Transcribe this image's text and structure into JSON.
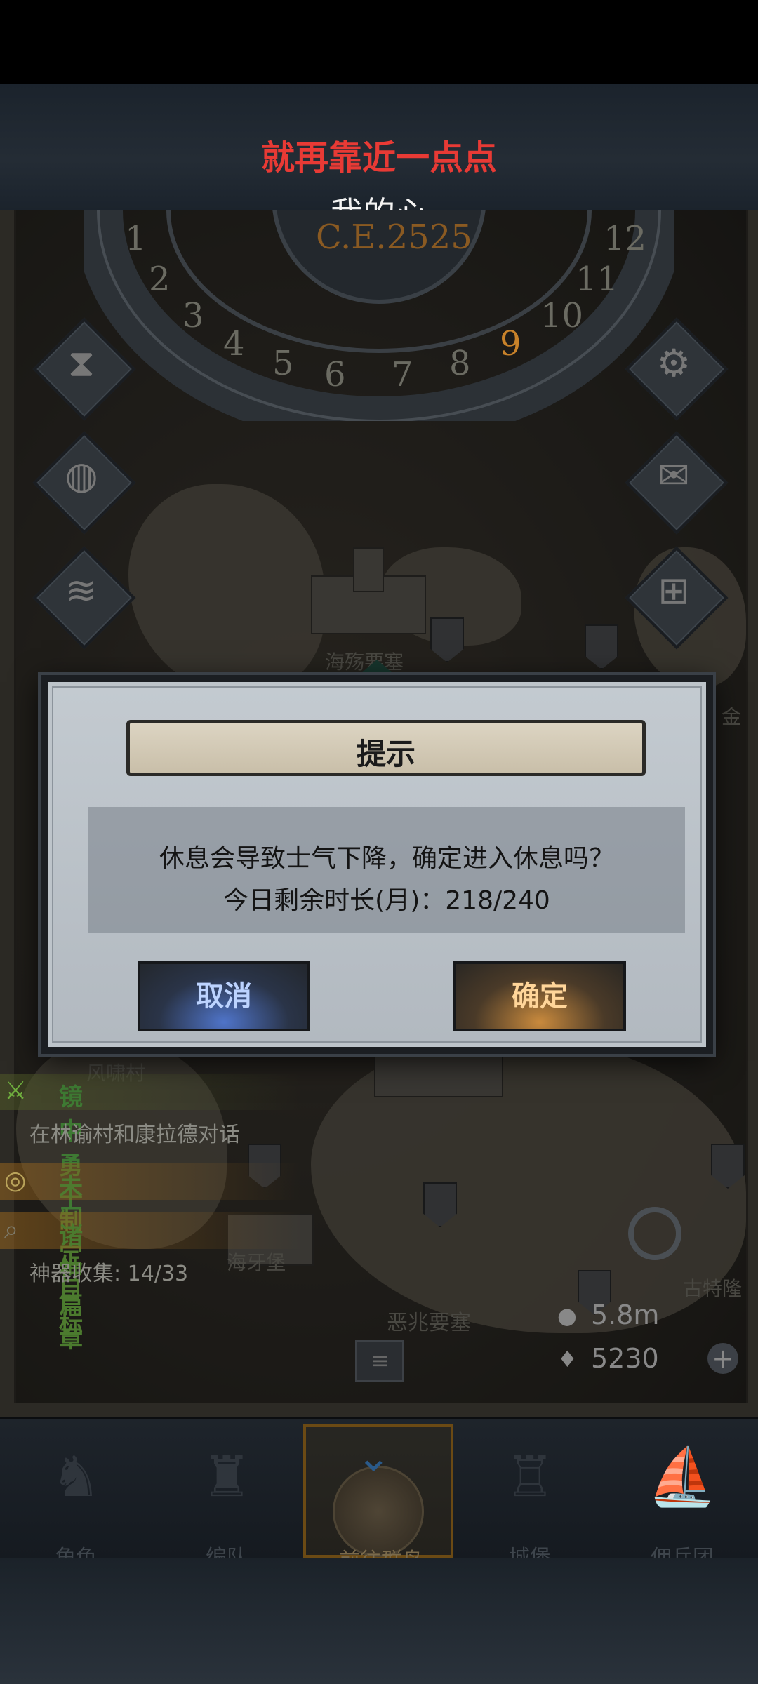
{
  "header": {
    "line1": "就再靠近一点点",
    "line2": "我的心",
    "line1_color": "#e83a35"
  },
  "dial": {
    "year": "C.E.2525",
    "numbers": [
      "1",
      "2",
      "3",
      "4",
      "5",
      "6",
      "7",
      "8",
      "9",
      "10",
      "11",
      "12"
    ],
    "active_month": "9"
  },
  "side_buttons": {
    "left": [
      "hourglass-icon",
      "bag-icon",
      "scroll-icon"
    ],
    "right": [
      "gear-icon",
      "mail-icon",
      "window-icon"
    ]
  },
  "map": {
    "labels": {
      "top_castle": "海殇要塞",
      "village": "风啸村",
      "left_fort": "海牙堡",
      "center_castle": "恶兆要塞",
      "right_castle": "古特隆",
      "edge_right": "金"
    }
  },
  "quests": [
    {
      "title": "镜中勇士",
      "subtitle": "在林谕村和康拉德对话",
      "icon": "crossed-swords-icon"
    },
    {
      "title": "未制定目标",
      "icon": "target-icon"
    },
    {
      "title": "诸神篇章",
      "subtitle": "神器收集: 14/33",
      "icon": "magnifier-icon"
    }
  ],
  "resources": {
    "silver": "5.8m",
    "crystal": "5230"
  },
  "nav": [
    {
      "label": "角色",
      "icon": "knight-icon"
    },
    {
      "label": "编队",
      "icon": "helmet-icon"
    },
    {
      "label": "前往群岛",
      "icon": "globe-icon"
    },
    {
      "label": "城堡",
      "icon": "castle-icon"
    },
    {
      "label": "佣兵团",
      "icon": "ship-icon"
    }
  ],
  "dialog": {
    "title": "提示",
    "message_line1": "休息会导致士气下降，确定进入休息吗？",
    "message_line2": "今日剩余时长(月)：218/240",
    "cancel_label": "取消",
    "confirm_label": "确定"
  }
}
